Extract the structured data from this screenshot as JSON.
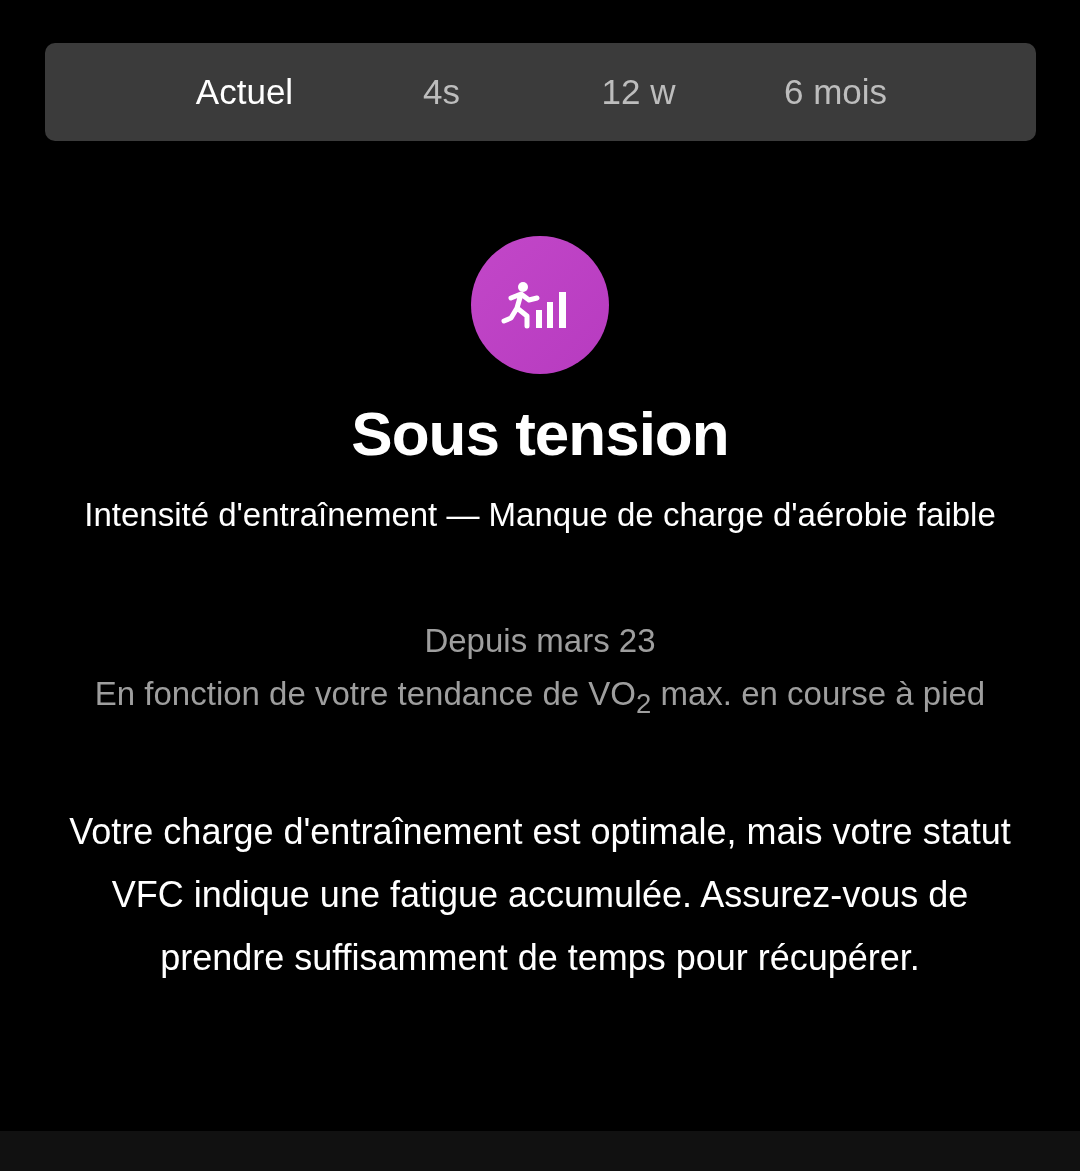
{
  "tabs": [
    {
      "label": "Actuel",
      "selected": true
    },
    {
      "label": "4s",
      "selected": false
    },
    {
      "label": "12 w",
      "selected": false
    },
    {
      "label": "6 mois",
      "selected": false
    }
  ],
  "status": {
    "title": "Sous tension",
    "subtitle": "Intensité d'entraînement — Manque de charge d'aérobie faible"
  },
  "basis": {
    "since": "Depuis mars 23",
    "note": "En fonction de votre tendance de VO$_{2}$ max. en course à pied"
  },
  "message": "Votre charge d'entraînement est optimale, mais votre statut VFC indique une fatigue accumulée. Assurez-vous de prendre suffisamment de temps pour récupérer."
}
